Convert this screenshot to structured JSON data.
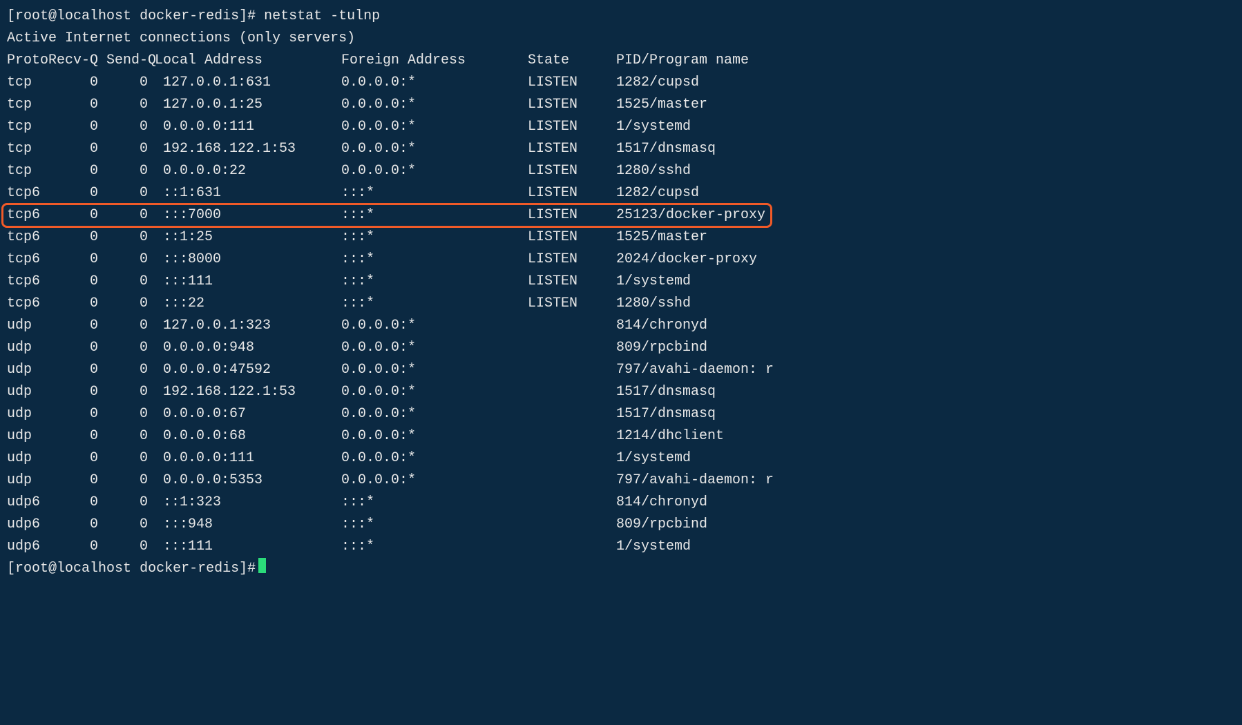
{
  "prompt1": {
    "user_host": "root@localhost",
    "cwd": "docker-redis",
    "symbol": "#",
    "command": "netstat -tulnp"
  },
  "header_line": "Active Internet connections (only servers)",
  "columns": {
    "proto": "Proto",
    "recvq": "Recv-Q",
    "sendq": "Send-Q",
    "local": "Local Address",
    "foreign": "Foreign Address",
    "state": "State",
    "pid": "PID/Program name"
  },
  "rows": [
    {
      "proto": "tcp",
      "recvq": "0",
      "sendq": "0",
      "local": "127.0.0.1:631",
      "foreign": "0.0.0.0:*",
      "state": "LISTEN",
      "pid": "1282/cupsd",
      "hl": false
    },
    {
      "proto": "tcp",
      "recvq": "0",
      "sendq": "0",
      "local": "127.0.0.1:25",
      "foreign": "0.0.0.0:*",
      "state": "LISTEN",
      "pid": "1525/master",
      "hl": false
    },
    {
      "proto": "tcp",
      "recvq": "0",
      "sendq": "0",
      "local": "0.0.0.0:111",
      "foreign": "0.0.0.0:*",
      "state": "LISTEN",
      "pid": "1/systemd",
      "hl": false
    },
    {
      "proto": "tcp",
      "recvq": "0",
      "sendq": "0",
      "local": "192.168.122.1:53",
      "foreign": "0.0.0.0:*",
      "state": "LISTEN",
      "pid": "1517/dnsmasq",
      "hl": false
    },
    {
      "proto": "tcp",
      "recvq": "0",
      "sendq": "0",
      "local": "0.0.0.0:22",
      "foreign": "0.0.0.0:*",
      "state": "LISTEN",
      "pid": "1280/sshd",
      "hl": false
    },
    {
      "proto": "tcp6",
      "recvq": "0",
      "sendq": "0",
      "local": "::1:631",
      "foreign": ":::*",
      "state": "LISTEN",
      "pid": "1282/cupsd",
      "hl": false
    },
    {
      "proto": "tcp6",
      "recvq": "0",
      "sendq": "0",
      "local": ":::7000",
      "foreign": ":::*",
      "state": "LISTEN",
      "pid": "25123/docker-proxy",
      "hl": true
    },
    {
      "proto": "tcp6",
      "recvq": "0",
      "sendq": "0",
      "local": "::1:25",
      "foreign": ":::*",
      "state": "LISTEN",
      "pid": "1525/master",
      "hl": false
    },
    {
      "proto": "tcp6",
      "recvq": "0",
      "sendq": "0",
      "local": ":::8000",
      "foreign": ":::*",
      "state": "LISTEN",
      "pid": "2024/docker-proxy",
      "hl": false
    },
    {
      "proto": "tcp6",
      "recvq": "0",
      "sendq": "0",
      "local": ":::111",
      "foreign": ":::*",
      "state": "LISTEN",
      "pid": "1/systemd",
      "hl": false
    },
    {
      "proto": "tcp6",
      "recvq": "0",
      "sendq": "0",
      "local": ":::22",
      "foreign": ":::*",
      "state": "LISTEN",
      "pid": "1280/sshd",
      "hl": false
    },
    {
      "proto": "udp",
      "recvq": "0",
      "sendq": "0",
      "local": "127.0.0.1:323",
      "foreign": "0.0.0.0:*",
      "state": "",
      "pid": "814/chronyd",
      "hl": false
    },
    {
      "proto": "udp",
      "recvq": "0",
      "sendq": "0",
      "local": "0.0.0.0:948",
      "foreign": "0.0.0.0:*",
      "state": "",
      "pid": "809/rpcbind",
      "hl": false
    },
    {
      "proto": "udp",
      "recvq": "0",
      "sendq": "0",
      "local": "0.0.0.0:47592",
      "foreign": "0.0.0.0:*",
      "state": "",
      "pid": "797/avahi-daemon: r",
      "hl": false
    },
    {
      "proto": "udp",
      "recvq": "0",
      "sendq": "0",
      "local": "192.168.122.1:53",
      "foreign": "0.0.0.0:*",
      "state": "",
      "pid": "1517/dnsmasq",
      "hl": false
    },
    {
      "proto": "udp",
      "recvq": "0",
      "sendq": "0",
      "local": "0.0.0.0:67",
      "foreign": "0.0.0.0:*",
      "state": "",
      "pid": "1517/dnsmasq",
      "hl": false
    },
    {
      "proto": "udp",
      "recvq": "0",
      "sendq": "0",
      "local": "0.0.0.0:68",
      "foreign": "0.0.0.0:*",
      "state": "",
      "pid": "1214/dhclient",
      "hl": false
    },
    {
      "proto": "udp",
      "recvq": "0",
      "sendq": "0",
      "local": "0.0.0.0:111",
      "foreign": "0.0.0.0:*",
      "state": "",
      "pid": "1/systemd",
      "hl": false
    },
    {
      "proto": "udp",
      "recvq": "0",
      "sendq": "0",
      "local": "0.0.0.0:5353",
      "foreign": "0.0.0.0:*",
      "state": "",
      "pid": "797/avahi-daemon: r",
      "hl": false
    },
    {
      "proto": "udp6",
      "recvq": "0",
      "sendq": "0",
      "local": "::1:323",
      "foreign": ":::*",
      "state": "",
      "pid": "814/chronyd",
      "hl": false
    },
    {
      "proto": "udp6",
      "recvq": "0",
      "sendq": "0",
      "local": ":::948",
      "foreign": ":::*",
      "state": "",
      "pid": "809/rpcbind",
      "hl": false
    },
    {
      "proto": "udp6",
      "recvq": "0",
      "sendq": "0",
      "local": ":::111",
      "foreign": ":::*",
      "state": "",
      "pid": "1/systemd",
      "hl": false
    }
  ],
  "prompt2": {
    "user_host": "root@localhost",
    "cwd": "docker-redis",
    "symbol": "#"
  }
}
